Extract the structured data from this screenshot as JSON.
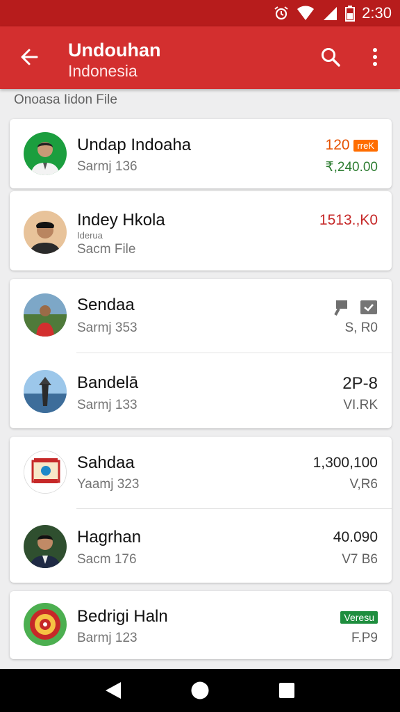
{
  "status_bar": {
    "time": "2:30"
  },
  "app_bar": {
    "title": "Undouhan",
    "subtitle": "Indonesia"
  },
  "section_header": "Onoasa Iidon File",
  "items": [
    {
      "name": "Undap Indoaha",
      "sub": "Sarmj 136",
      "value": "120",
      "badge": "rreK",
      "value2": "₹,240.00",
      "value_color": "#e65100",
      "badge_color": "#ff6d00",
      "value2_color": "#2e7d32"
    },
    {
      "name": "Indey Hkola",
      "micro": "Iderua",
      "sub": "Sacm File",
      "value": "1513.,K0",
      "value_color": "#c62828"
    },
    {
      "name": "Sendaa",
      "sub": "Sarmj 353",
      "value2": "S, R0"
    },
    {
      "name": "Bandelā",
      "sub": "Sarmj 133",
      "value": "2P-8",
      "value2": "VI.RK"
    },
    {
      "name": "Sahdaa",
      "sub": "Yaamj 323",
      "value": "1,300,100",
      "value2": "V,R6"
    },
    {
      "name": "Hagrhan",
      "sub": "Sacm 176",
      "value": "40.090",
      "value2": "V7 B6"
    },
    {
      "name": "Bedrigi Haln",
      "sub": "Barmj 123",
      "badge": "Veresu",
      "value2": "F.P9",
      "badge_color": "#1e8e3e"
    }
  ]
}
